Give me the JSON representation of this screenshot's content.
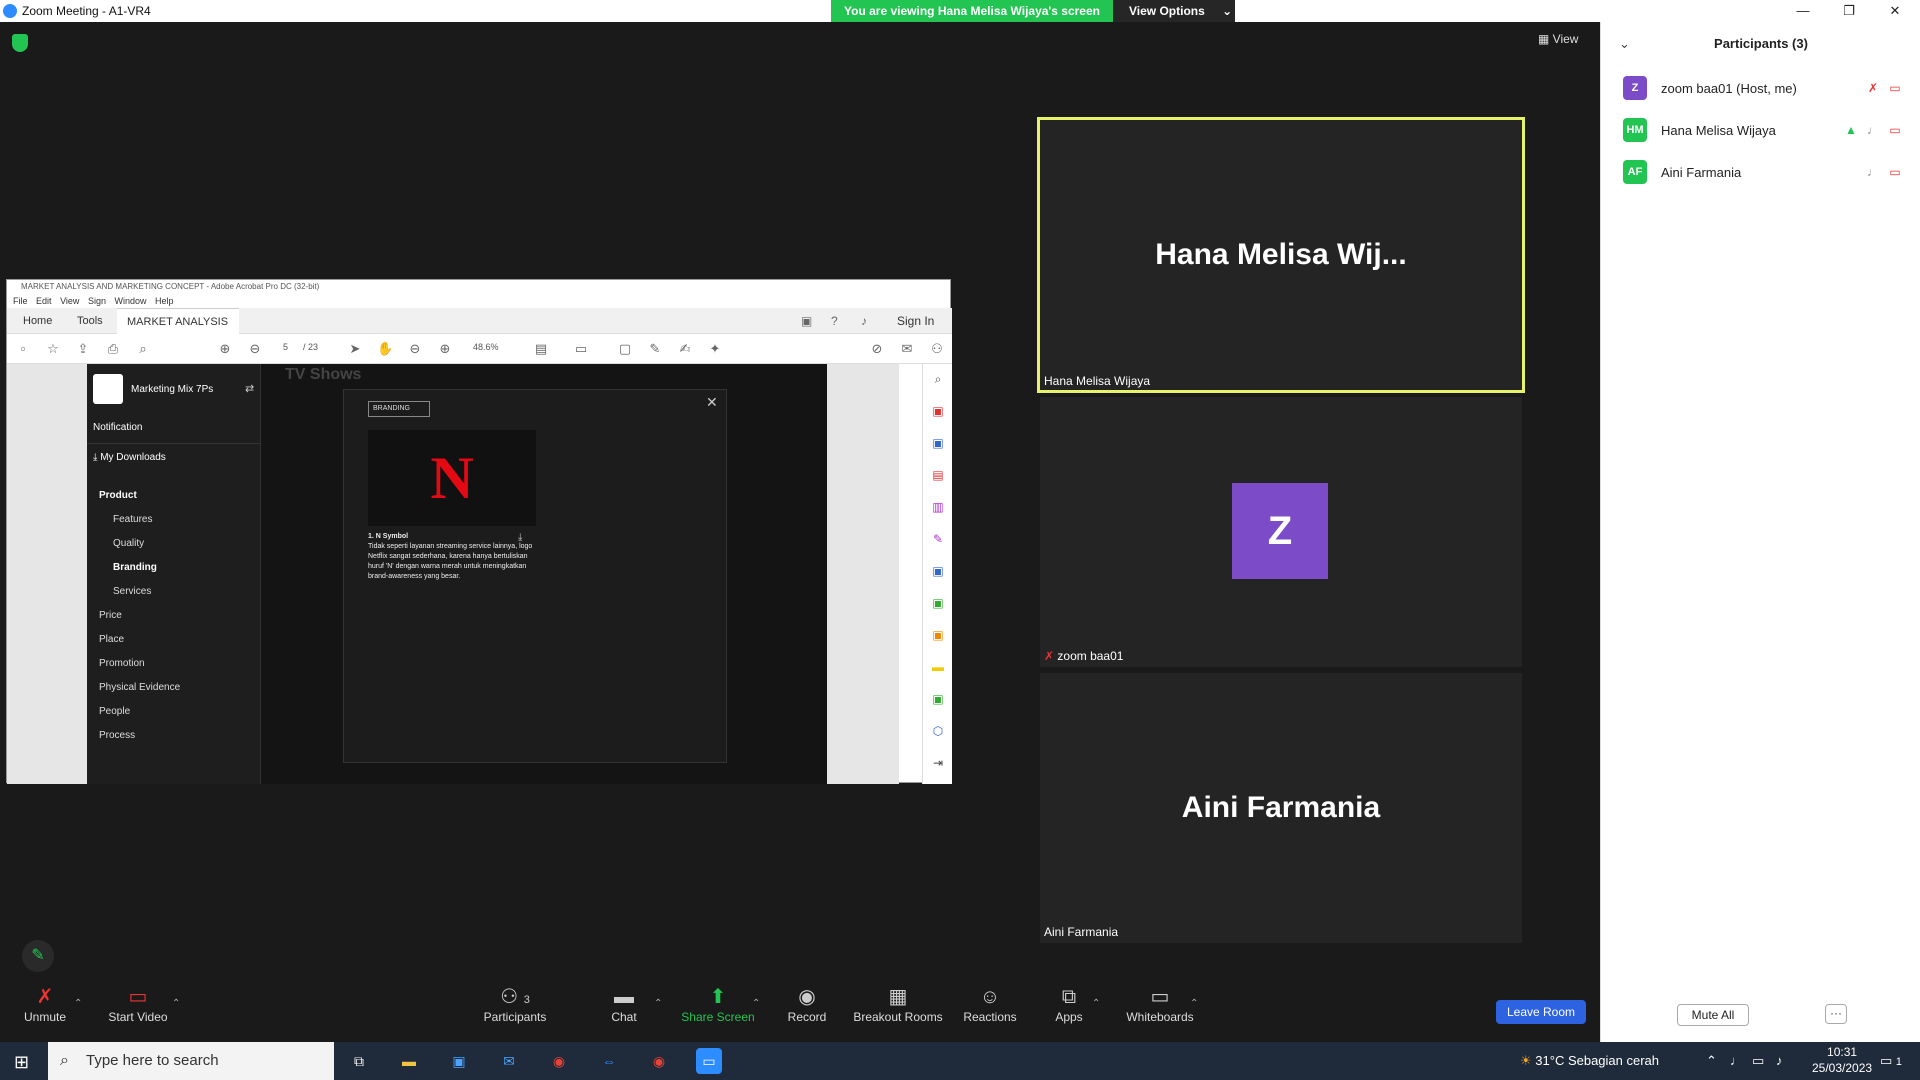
{
  "window": {
    "title": "Zoom Meeting - A1-VR4",
    "minimize": "—",
    "restore": "❐",
    "close": "✕"
  },
  "banner": {
    "text": "You are viewing Hana Melisa Wijaya's screen",
    "view_options": "View Options"
  },
  "view_label": "View",
  "acrobat": {
    "title": "MARKET ANALYSIS AND MARKETING CONCEPT - Adobe Acrobat Pro DC (32-bit)",
    "menu": [
      "File",
      "Edit",
      "View",
      "Sign",
      "Window",
      "Help"
    ],
    "tabs": {
      "home": "Home",
      "tools": "Tools",
      "doc": "MARKET ANALYSIS ..."
    },
    "sign_in": "Sign In",
    "page_current": "5",
    "page_total": "/ 23",
    "zoom": "48.6%"
  },
  "slide": {
    "header": "Marketing Mix 7Ps",
    "bg_title": "TV Shows",
    "notification": "Notification",
    "my_downloads": "My Downloads",
    "product": "Product",
    "features": "Features",
    "quality": "Quality",
    "branding": "Branding",
    "services": "Services",
    "price": "Price",
    "place": "Place",
    "promotion": "Promotion",
    "physical_evidence": "Physical Evidence",
    "people": "People",
    "process": "Process",
    "modal_select": "BRANDING",
    "logo_letter": "N",
    "item_title": "1. N Symbol",
    "item_text": "Tidak seperti layanan streaming service lainnya, logo Netflix sangat sederhana, karena hanya bertuliskan huruf 'N' dengan warna merah untuk meningkatkan brand-awareness yang besar."
  },
  "tiles": {
    "hana_big": "Hana Melisa Wij...",
    "hana_label": "Hana Melisa Wijaya",
    "z_letter": "Z",
    "zoom_label": "zoom baa01",
    "aini_big": "Aini Farmania",
    "aini_label": "Aini Farmania"
  },
  "participants": {
    "title": "Participants (3)",
    "list": [
      {
        "initials": "Z",
        "name": "zoom baa01 (Host, me)",
        "color": "#7c4cc8"
      },
      {
        "initials": "HM",
        "name": "Hana Melisa Wijaya",
        "color": "#23c552"
      },
      {
        "initials": "AF",
        "name": "Aini Farmania",
        "color": "#23c552"
      }
    ],
    "mute_all": "Mute All",
    "more": "···"
  },
  "toolbar": {
    "unmute": "Unmute",
    "start_video": "Start Video",
    "participants": "Participants",
    "participants_count": "3",
    "chat": "Chat",
    "share_screen": "Share Screen",
    "record": "Record",
    "breakout_rooms": "Breakout Rooms",
    "reactions": "Reactions",
    "apps": "Apps",
    "whiteboards": "Whiteboards",
    "leave_room": "Leave Room"
  },
  "taskbar": {
    "search_placeholder": "Type here to search",
    "weather": "31°C  Sebagian cerah",
    "time": "10:31",
    "date": "25/03/2023",
    "notif_count": "1"
  },
  "colors": {
    "green": "#23c552",
    "blue": "#2d63e0",
    "accent_border": "#e6f26a"
  }
}
